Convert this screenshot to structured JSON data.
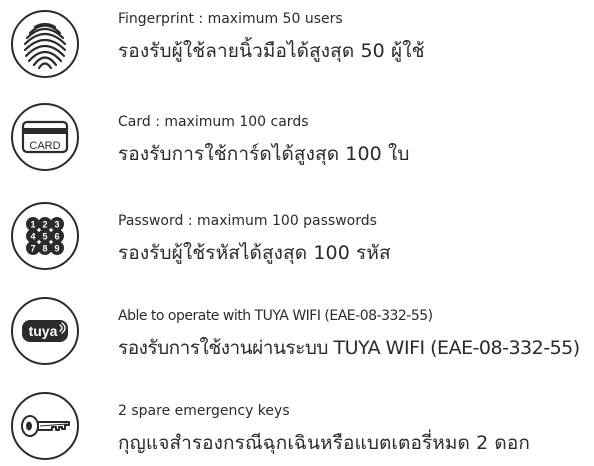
{
  "features": [
    {
      "icon": "fingerprint-icon",
      "title": "Fingerprint : maximum 50 users",
      "thai": "รองรับผู้ใช้ลายนิ้วมือได้สูงสุด 50 ผู้ใช้"
    },
    {
      "icon": "card-icon",
      "icon_label": "CARD",
      "title": "Card : maximum 100 cards",
      "thai": "รองรับการใช้การ์ดได้สูงสุด 100 ใบ"
    },
    {
      "icon": "keypad-icon",
      "icon_digits": [
        "1",
        "2",
        "3",
        "4",
        "5",
        "6",
        "7",
        "8",
        "9"
      ],
      "title": "Password : maximum 100 passwords",
      "thai": "รองรับผู้ใช้รหัสได้สูงสุด 100 รหัส"
    },
    {
      "icon": "tuya-logo-icon",
      "icon_label": "tuya",
      "title": "Able to operate with TUYA WIFI (EAE-08-332-55)",
      "thai": "รองรับการใช้งานผ่านระบบ TUYA WIFI (EAE-08-332-55)"
    },
    {
      "icon": "key-icon",
      "title": "2 spare emergency keys",
      "thai": "กุญแจสำรองกรณีฉุกเฉินหรือแบตเตอรี่หมด 2 ดอก"
    }
  ],
  "colors": {
    "text": "#2b2b2b",
    "icon_stroke": "#2b2b2b"
  }
}
